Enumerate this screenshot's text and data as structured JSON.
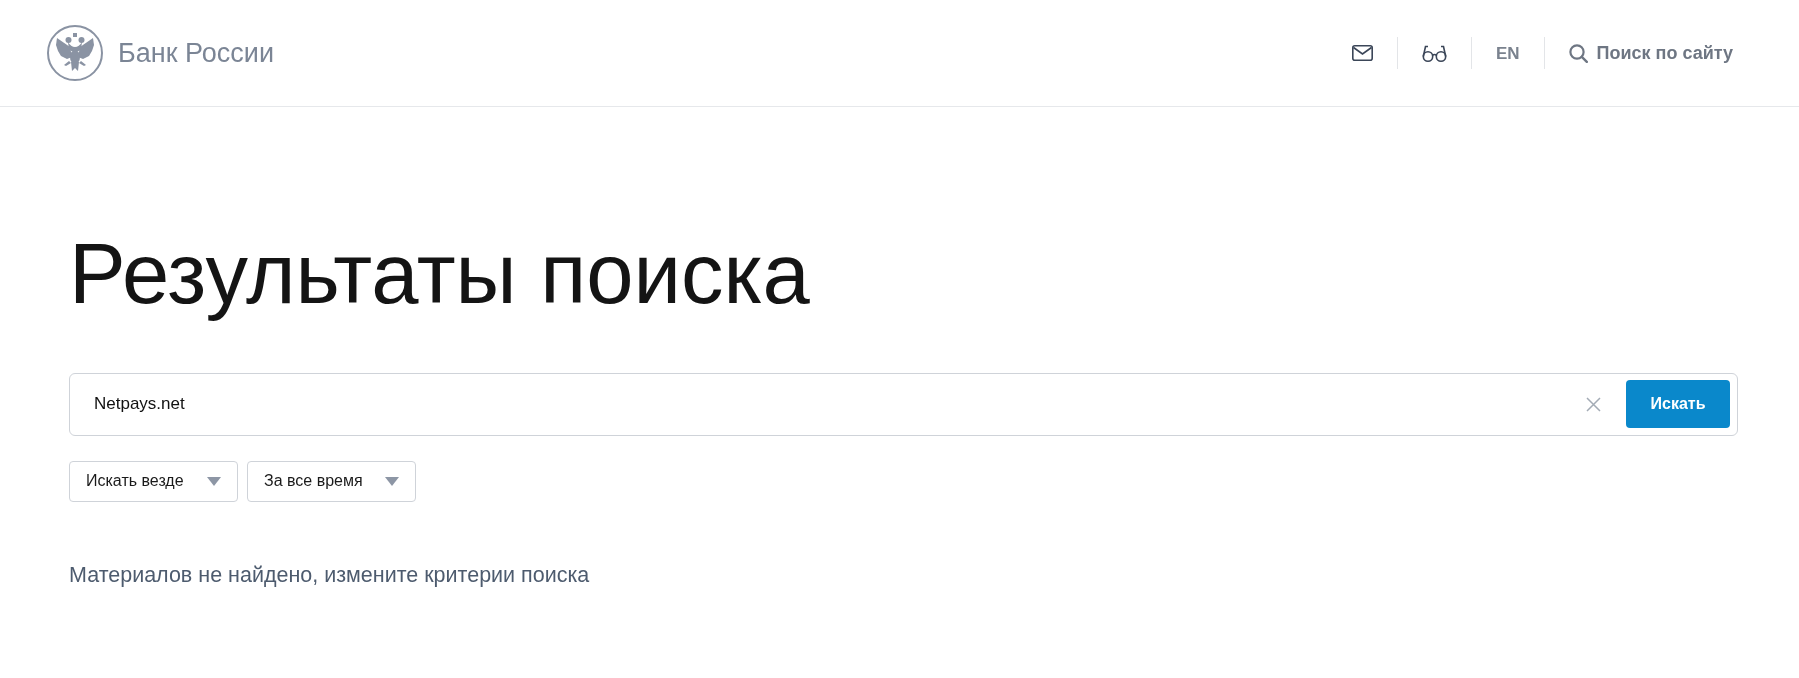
{
  "header": {
    "logo_text": "Банк России",
    "language": "EN",
    "site_search": "Поиск по сайту"
  },
  "page_title": "Результаты поиска",
  "search": {
    "value": "Netpays.net",
    "button": "Искать"
  },
  "filters": [
    {
      "label": "Искать везде"
    },
    {
      "label": "За все время"
    }
  ],
  "message": "Материалов не найдено, измените критерии поиска"
}
